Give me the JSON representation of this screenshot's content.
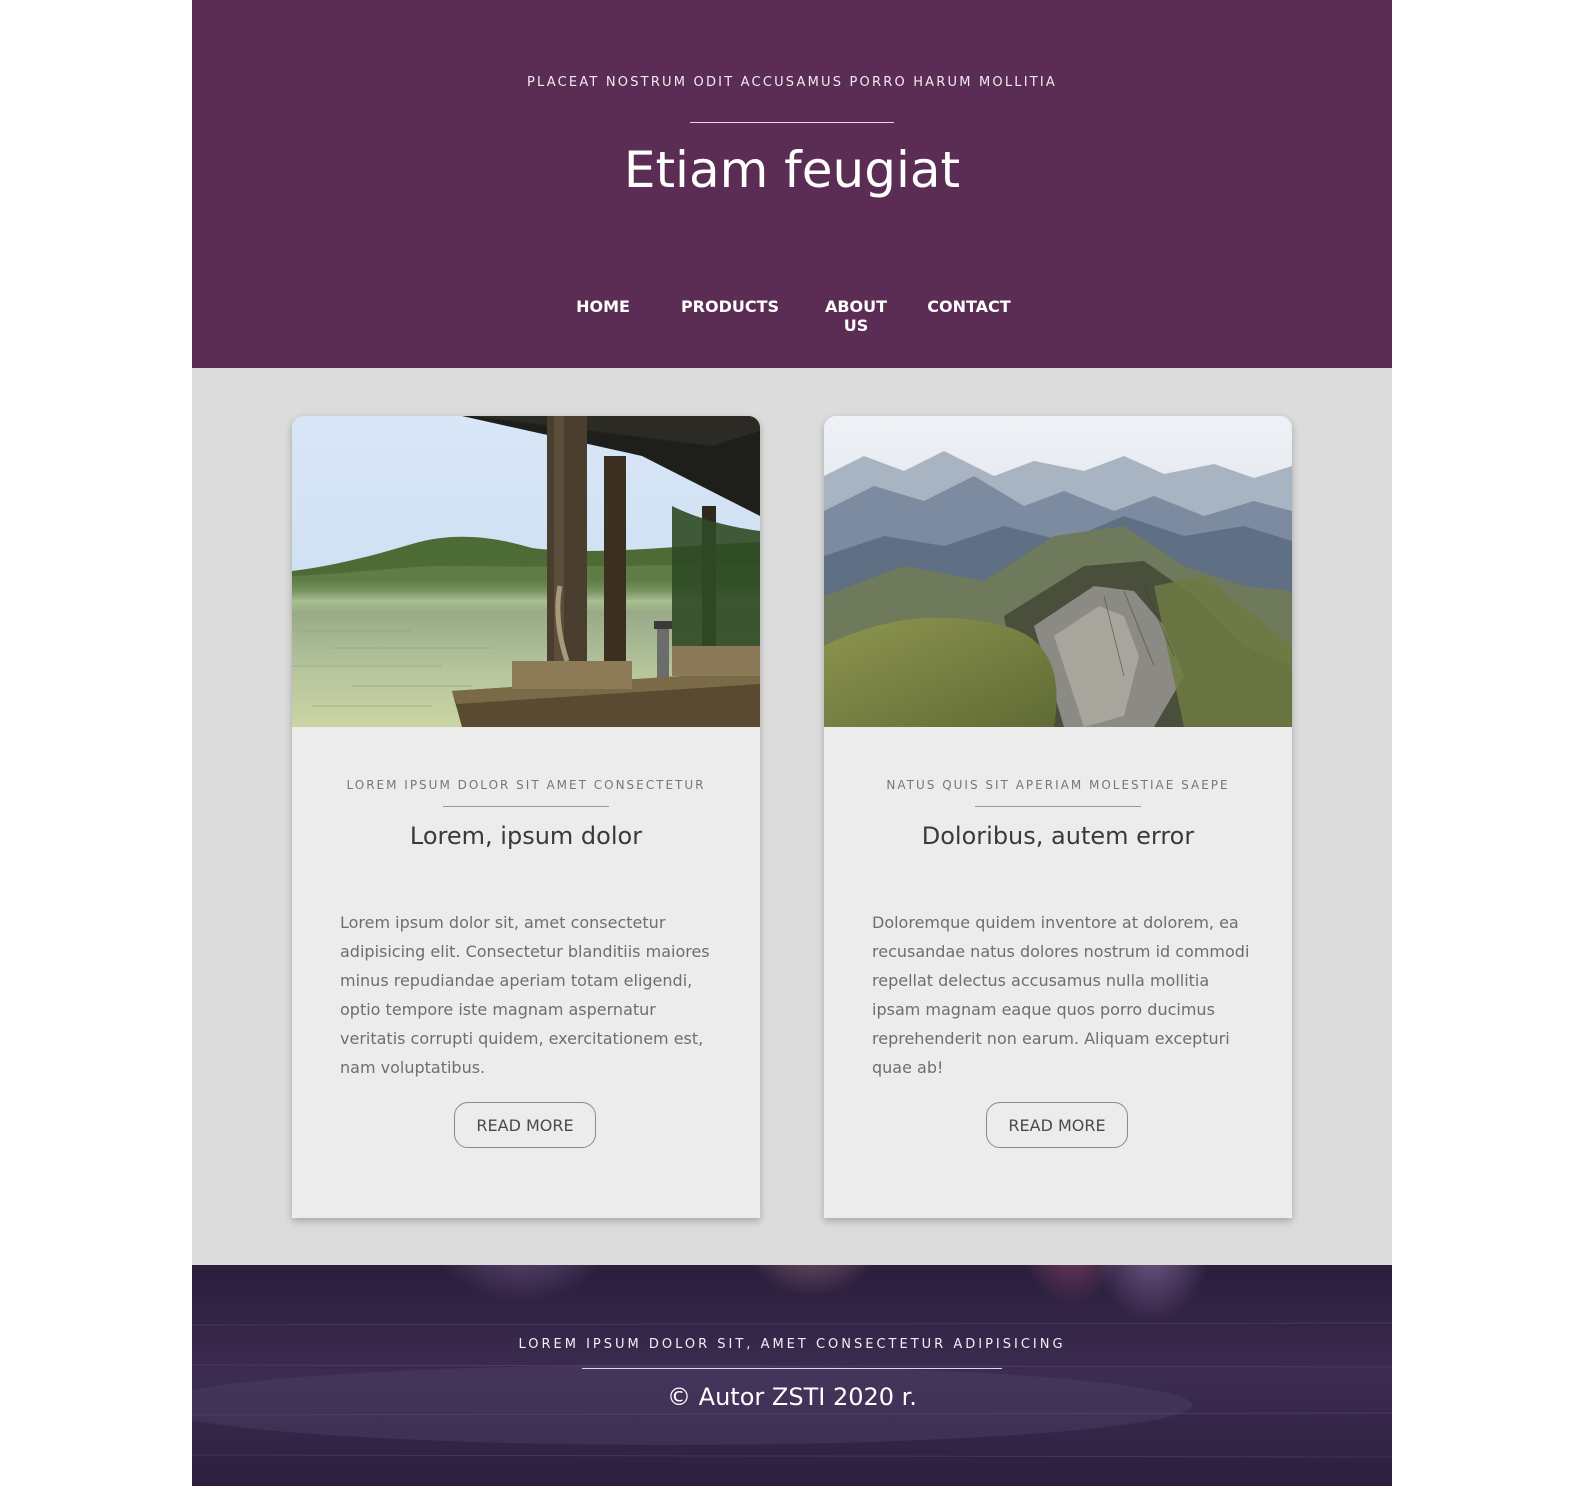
{
  "header": {
    "eyebrow": "PLACEAT NOSTRUM ODIT ACCUSAMUS PORRO HARUM MOLLITIA",
    "title": "Etiam feugiat",
    "background_color": "#5c2d54",
    "nav": [
      {
        "label": "HOME"
      },
      {
        "label": "PRODUCTS"
      },
      {
        "label": "ABOUT US"
      },
      {
        "label": "CONTACT"
      }
    ]
  },
  "cards": [
    {
      "image": "lake-dock-photo",
      "kicker": "LOREM IPSUM DOLOR SIT AMET CONSECTETUR",
      "title": "Lorem, ipsum dolor",
      "body": "Lorem ipsum dolor sit, amet consectetur adipisicing elit. Consectetur blanditiis maiores minus repudiandae aperiam totam eligendi, optio tempore iste magnam aspernatur veritatis corrupti quidem, exercitationem est, nam voluptatibus.",
      "button": "READ MORE"
    },
    {
      "image": "mountain-ridge-photo",
      "kicker": "NATUS QUIS SIT APERIAM MOLESTIAE SAEPE",
      "title": "Doloribus, autem error",
      "body": "Doloremque quidem inventore at dolorem, ea recusandae natus dolores nostrum id commodi repellat delectus accusamus nulla mollitia ipsam magnam eaque quos porro ducimus reprehenderit non earum. Aliquam excepturi quae ab!",
      "button": "READ MORE"
    }
  ],
  "footer": {
    "eyebrow": "LOREM IPSUM DOLOR SIT, AMET CONSECTETUR ADIPISICING",
    "copyright": "© Autor ZSTI 2020 r.",
    "background": "water-reflection-photo"
  }
}
